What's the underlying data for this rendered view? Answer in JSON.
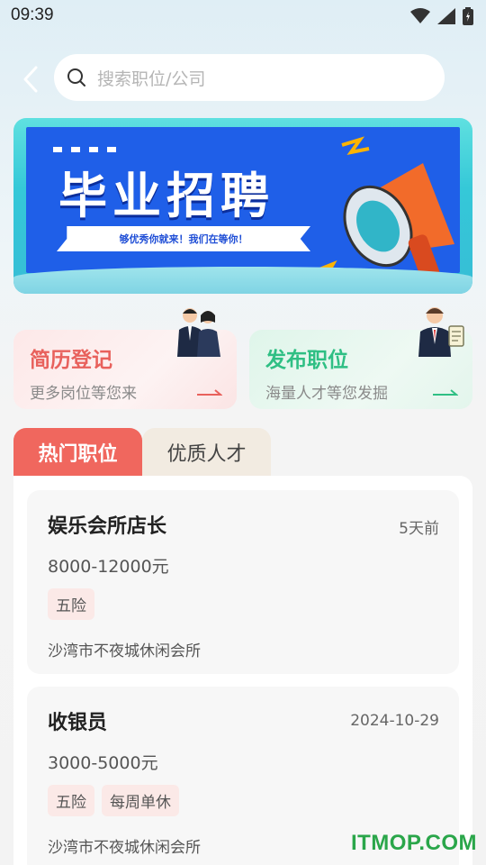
{
  "status_bar": {
    "time": "09:39"
  },
  "search": {
    "placeholder": "搜索职位/公司"
  },
  "banner": {
    "title": "毕业招聘",
    "subtitle": "够优秀你就来！我们在等你！"
  },
  "quick_cards": [
    {
      "title": "简历登记",
      "subtitle": "更多岗位等您来",
      "accent": "#e8615c"
    },
    {
      "title": "发布职位",
      "subtitle": "海量人才等您发掘",
      "accent": "#2fbf84"
    }
  ],
  "tabs": [
    {
      "label": "热门职位",
      "active": true
    },
    {
      "label": "优质人才",
      "active": false
    }
  ],
  "jobs": [
    {
      "title": "娱乐会所店长",
      "date": "5天前",
      "salary": "8000-12000元",
      "tags": [
        "五险"
      ],
      "company": "沙湾市不夜城休闲会所"
    },
    {
      "title": "收银员",
      "date": "2024-10-29",
      "salary": "3000-5000元",
      "tags": [
        "五险",
        "每周单休"
      ],
      "company": "沙湾市不夜城休闲会所"
    }
  ],
  "watermark": "ITMOP.COM",
  "colors": {
    "accent_red": "#f0675e",
    "accent_green": "#2fbf84",
    "banner_blue": "#1f5fe8"
  }
}
